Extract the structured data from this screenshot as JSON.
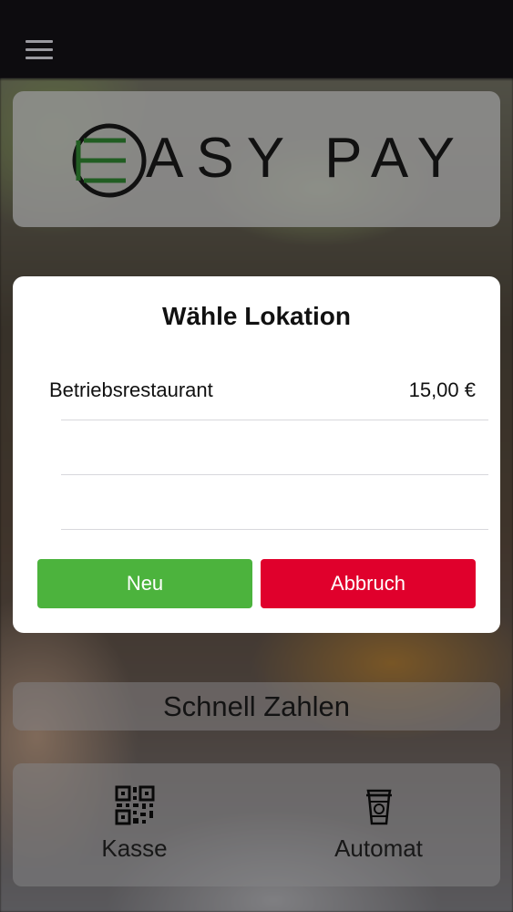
{
  "header": {
    "menu_icon": "hamburger-menu-icon"
  },
  "logo": {
    "text": "ASY PAY",
    "mark_letter": "E",
    "accent_color": "#3aa13b"
  },
  "dialog": {
    "title": "Wähle Lokation",
    "locations": [
      {
        "name": "Betriebsrestaurant",
        "price": "15,00 €"
      },
      {
        "name": "",
        "price": ""
      },
      {
        "name": "",
        "price": ""
      }
    ],
    "new_label": "Neu",
    "cancel_label": "Abbruch",
    "new_color": "#4cb33d",
    "cancel_color": "#e0002c"
  },
  "quick_pay": {
    "label": "Schnell Zahlen"
  },
  "tabs": [
    {
      "label": "Kasse",
      "icon": "qr-code-icon"
    },
    {
      "label": "Automat",
      "icon": "coffee-cup-icon"
    }
  ]
}
